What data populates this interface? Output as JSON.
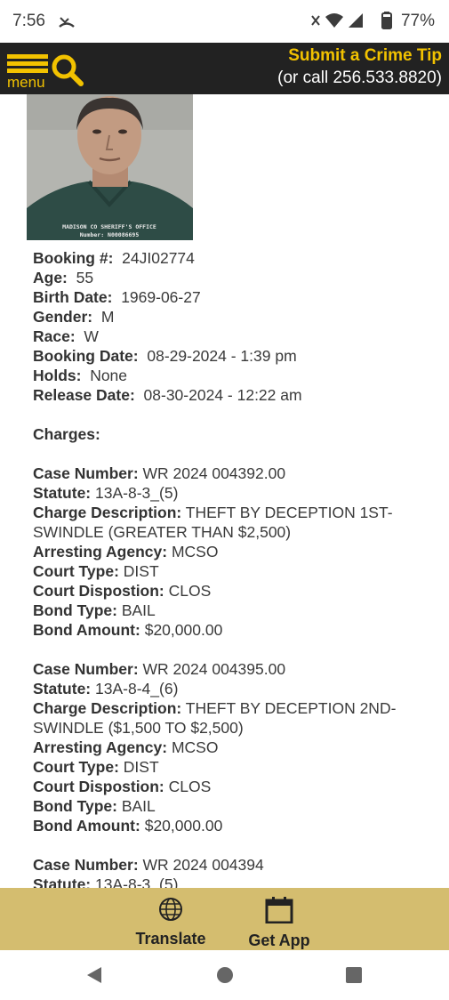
{
  "status_bar": {
    "time": "7:56",
    "battery": "77%"
  },
  "header": {
    "menu_label": "menu",
    "tip_title": "Submit a Crime Tip",
    "tip_phone": "(or call 256.533.8820)"
  },
  "colors": {
    "header_bg": "#222222",
    "accent_yellow": "#f2c200",
    "bottom_bar_bg": "#d4bd6f"
  },
  "mugshot": {
    "caption_line1": "MADISON CO SHERIFF'S OFFICE",
    "caption_line2": "Number: N00086695"
  },
  "booking": {
    "booking_number_label": "Booking #:",
    "booking_number": "24JI02774",
    "age_label": "Age:",
    "age": "55",
    "birth_date_label": "Birth Date:",
    "birth_date": "1969-06-27",
    "gender_label": "Gender:",
    "gender": "M",
    "race_label": "Race:",
    "race": "W",
    "booking_date_label": "Booking Date:",
    "booking_date": "08-29-2024 - 1:39 pm",
    "holds_label": "Holds:",
    "holds": "None",
    "release_date_label": "Release Date:",
    "release_date": "08-30-2024 - 12:22 am"
  },
  "charges_heading": "Charges:",
  "charge_labels": {
    "case_number": "Case Number:",
    "statute": "Statute:",
    "charge_description": "Charge Description:",
    "arresting_agency": "Arresting Agency:",
    "court_type": "Court Type:",
    "court_disposition": "Court Dispostion:",
    "bond_type": "Bond Type:",
    "bond_amount": "Bond Amount:"
  },
  "charges": [
    {
      "case_number": "WR 2024 004392.00",
      "statute": "13A-8-3_(5)",
      "charge_description": "THEFT BY DECEPTION 1ST-SWINDLE (GREATER THAN $2,500)",
      "arresting_agency": "MCSO",
      "court_type": "DIST",
      "court_disposition": "CLOS",
      "bond_type": "BAIL",
      "bond_amount": "$20,000.00"
    },
    {
      "case_number": "WR 2024 004395.00",
      "statute": "13A-8-4_(6)",
      "charge_description": "THEFT BY DECEPTION 2ND-SWINDLE ($1,500 TO $2,500)",
      "arresting_agency": "MCSO",
      "court_type": "DIST",
      "court_disposition": "CLOS",
      "bond_type": "BAIL",
      "bond_amount": "$20,000.00"
    },
    {
      "case_number": "WR 2024 004394",
      "statute": "13A-8-3_(5)"
    }
  ],
  "bottom_bar": {
    "translate_label": "Translate",
    "get_app_label": "Get App"
  }
}
